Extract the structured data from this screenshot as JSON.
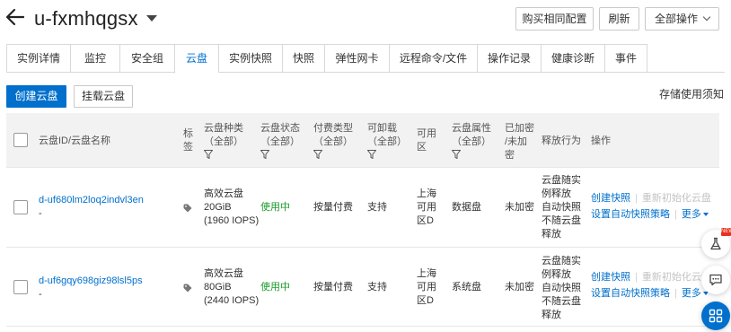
{
  "header": {
    "instance_name": "u-fxmhqgsx",
    "buy_same_label": "购买相同配置",
    "refresh_label": "刷新",
    "all_actions_label": "全部操作"
  },
  "tabs": [
    {
      "label": "实例详情"
    },
    {
      "label": "监控"
    },
    {
      "label": "安全组"
    },
    {
      "label": "云盘"
    },
    {
      "label": "实例快照"
    },
    {
      "label": "快照"
    },
    {
      "label": "弹性网卡"
    },
    {
      "label": "远程命令/文件"
    },
    {
      "label": "操作记录"
    },
    {
      "label": "健康诊断"
    },
    {
      "label": "事件"
    }
  ],
  "active_tab": "云盘",
  "toolbar": {
    "create_label": "创建云盘",
    "mount_label": "挂载云盘",
    "notice_label": "存储使用须知"
  },
  "table": {
    "columns": {
      "id": "云盘ID/云盘名称",
      "tag_1": "标",
      "tag_2": "签",
      "type_1": "云盘种类",
      "type_2": "（全部）",
      "status_1": "云盘状态",
      "status_2": "（全部）",
      "billing_1": "付费类型",
      "billing_2": "（全部）",
      "removable_1": "可卸载",
      "removable_2": "（全部）",
      "zone_1": "可用",
      "zone_2": "区",
      "attr_1": "云盘属性",
      "attr_2": "（全部）",
      "enc_1": "已加密",
      "enc_2": "/未加",
      "enc_3": "密",
      "release": "释放行为",
      "ops": "操作"
    },
    "rows": [
      {
        "id": "d-uf680lm2loq2indvl3en",
        "name": "-",
        "type_1": "高效云盘",
        "type_2": "20GiB",
        "type_3": "(1960 IOPS)",
        "status": "使用中",
        "billing": "按量付费",
        "removable": "支持",
        "zone_1": "上海",
        "zone_2": "可用",
        "zone_3": "区D",
        "attr": "数据盘",
        "encryption": "未加密",
        "release_1": "云盘随实",
        "release_2": "例释放",
        "release_3": "自动快照",
        "release_4": "不随云盘",
        "release_5": "释放",
        "op_create_snapshot": "创建快照",
        "op_reinit": "重新初始化云盘",
        "op_auto_policy": "设置自动快照策略",
        "op_more": "更多"
      },
      {
        "id": "d-uf6gqy698giz98lsl5ps",
        "name": "-",
        "type_1": "高效云盘",
        "type_2": "80GiB",
        "type_3": "(2440 IOPS)",
        "status": "使用中",
        "billing": "按量付费",
        "removable": "支持",
        "zone_1": "上海",
        "zone_2": "可用",
        "zone_3": "区D",
        "attr": "系统盘",
        "encryption": "未加密",
        "release_1": "云盘随实",
        "release_2": "例释放",
        "release_3": "自动快照",
        "release_4": "不随云盘",
        "release_5": "释放",
        "op_create_snapshot": "创建快照",
        "op_reinit": "重新初始化云盘",
        "op_auto_policy": "设置自动快照策略",
        "op_more": "更多"
      }
    ]
  },
  "floating": {
    "new_badge": "NEW"
  },
  "colors": {
    "primary": "#0070cc",
    "status_green": "#1b9b2a",
    "disabled": "#c3c3c3",
    "header_bg": "#f2f2f2"
  }
}
